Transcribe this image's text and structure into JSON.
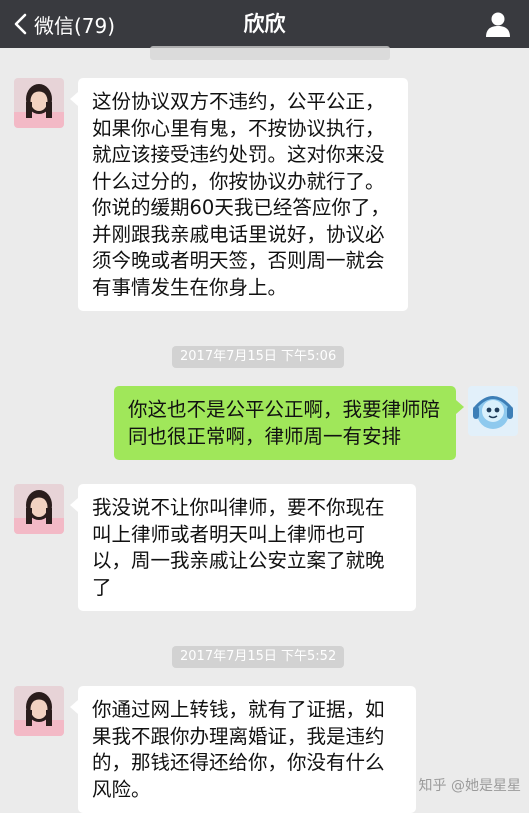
{
  "nav": {
    "back_label": "微信(79)",
    "title": "欣欣"
  },
  "messages": [
    {
      "direction": "in",
      "text": "这份协议双方不违约，公平公正，如果你心里有鬼，不按协议执行，就应该接受违约处罚。这对你来没什么过分的，你按协议办就行了。你说的缓期60天我已经答应你了，并刚跟我亲戚电话里说好，协议必须今晚或者明天签，否则周一就会有事情发生在你身上。"
    },
    {
      "direction": "out",
      "text": "你这也不是公平公正啊，我要律师陪同也很正常啊，律师周一有安排"
    },
    {
      "direction": "in",
      "text": "我没说不让你叫律师，要不你现在叫上律师或者明天叫上律师也可以，周一我亲戚让公安立案了就晚了"
    },
    {
      "direction": "in",
      "text": "你通过网上转钱，就有了证据，如果我不跟你办理离婚证，我是违约的，那钱还得还给你，你没有什么风险。"
    }
  ],
  "timestamps": [
    "2017年7月15日 下午5:06",
    "2017年7月15日 下午5:52"
  ],
  "watermark": "知乎 @她是星星",
  "colors": {
    "nav_bg": "#393a3f",
    "chat_bg": "#ebebeb",
    "incoming_bubble": "#ffffff",
    "outgoing_bubble": "#a0e75a",
    "timestamp_bg": "#d2d2d2"
  },
  "icons": [
    "chevron-left-icon",
    "person-icon",
    "girl-avatar",
    "cartoon-avatar"
  ]
}
